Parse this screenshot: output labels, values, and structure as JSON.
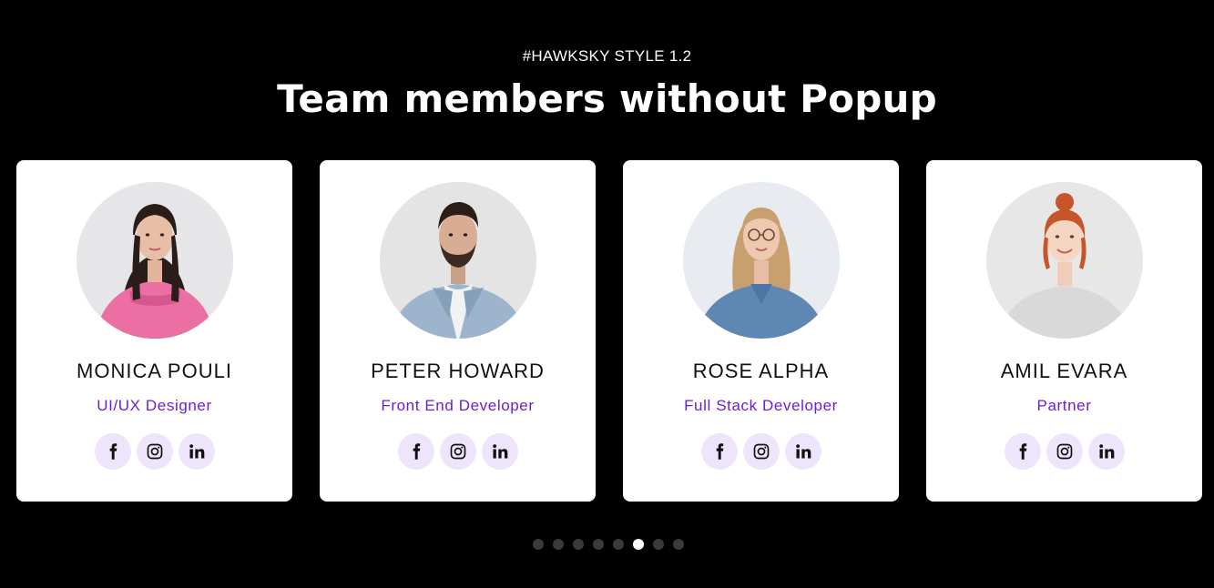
{
  "header": {
    "eyebrow": "#HAWKSKY STYLE 1.2",
    "title": "Team members without Popup"
  },
  "colors": {
    "background": "#000000",
    "card": "#ffffff",
    "accent": "#6a1fd6",
    "social_bg": "#eee4fb",
    "dot_inactive": "#3a3a3a",
    "dot_active": "#ffffff"
  },
  "members": [
    {
      "name": "MONICA POULI",
      "role": "UI/UX Designer",
      "socials": [
        "facebook-icon",
        "instagram-icon",
        "linkedin-icon"
      ]
    },
    {
      "name": "PETER HOWARD",
      "role": "Front End Developer",
      "socials": [
        "facebook-icon",
        "instagram-icon",
        "linkedin-icon"
      ]
    },
    {
      "name": "ROSE ALPHA",
      "role": "Full Stack Developer",
      "socials": [
        "facebook-icon",
        "instagram-icon",
        "linkedin-icon"
      ]
    },
    {
      "name": "AMIL EVARA",
      "role": "Partner",
      "socials": [
        "facebook-icon",
        "instagram-icon",
        "linkedin-icon"
      ]
    }
  ],
  "carousel": {
    "total_pages": 8,
    "active_page": 6
  }
}
